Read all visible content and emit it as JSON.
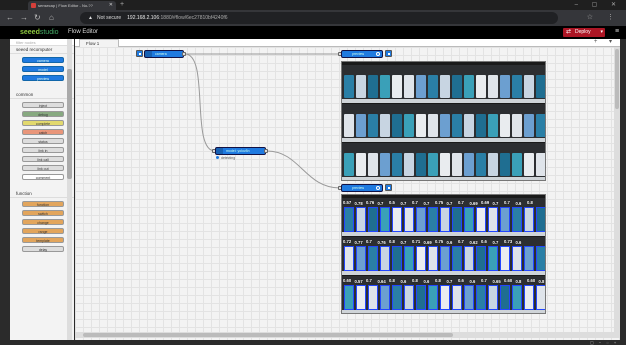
{
  "browser": {
    "tab_title": "sensecap | Flow Editor - No-??",
    "warning": "Not secure",
    "url_host": "192.168.2.106",
    "url_rest": ":1880/#flow/6ec27810bf4240f6"
  },
  "header": {
    "logo": "seeed",
    "logo_suffix": "studio",
    "title": "Flow Editor",
    "deploy_label": "Deploy"
  },
  "palette": {
    "search": "filter nodes",
    "categories": [
      {
        "label": "seeed recomputer",
        "nodes": [
          {
            "label": "camera",
            "style": "blue"
          },
          {
            "label": "model",
            "style": "blue"
          },
          {
            "label": "preview",
            "style": "blue"
          }
        ]
      },
      {
        "label": "common",
        "nodes": [
          {
            "label": "inject",
            "style": "grey"
          },
          {
            "label": "debug",
            "style": "green"
          },
          {
            "label": "complete",
            "style": "salmon"
          },
          {
            "label": "catch",
            "style": "orange"
          },
          {
            "label": "status",
            "style": "grey"
          },
          {
            "label": "link in",
            "style": "grey"
          },
          {
            "label": "link call",
            "style": "grey"
          },
          {
            "label": "link out",
            "style": "grey"
          },
          {
            "label": "comment",
            "style": "white"
          }
        ]
      },
      {
        "label": "function",
        "nodes": [
          {
            "label": "function",
            "style": "yellow"
          },
          {
            "label": "switch",
            "style": "yellow"
          },
          {
            "label": "change",
            "style": "yellow"
          },
          {
            "label": "range",
            "style": "yellow"
          },
          {
            "label": "template",
            "style": "yellow"
          },
          {
            "label": "delay",
            "style": "grey"
          }
        ]
      }
    ]
  },
  "workspace": {
    "tab": "Flow 1",
    "nodes": {
      "camera": "camera",
      "model": "model: yolov8n",
      "model_status": "detecting",
      "preview_top": "preview",
      "preview_bottom": "preview"
    }
  },
  "detections": {
    "row1": [
      "0.57",
      "0.78",
      "0.76",
      "0.7",
      "0.5",
      "0.7",
      "0.7",
      "0.7",
      "0.75",
      "0.7",
      "0.7",
      "0.69",
      "0.69",
      "0.7",
      "0.7",
      "0.6",
      "0.8"
    ],
    "row2": [
      "0.72",
      "0.77",
      "0.7",
      "0.76",
      "0.8",
      "0.7",
      "0.71",
      "0.69",
      "0.75",
      "0.6",
      "0.7",
      "0.62",
      "0.6",
      "0.7",
      "0.73",
      "0.6"
    ],
    "row3": [
      "0.60",
      "0.57",
      "0.7",
      "0.64",
      "0.8",
      "0.6",
      "0.8",
      "0.6",
      "0.8",
      "0.7",
      "0.6",
      "0.6",
      "0.7",
      "0.65",
      "0.60",
      "0.8",
      "0.60",
      "0.8"
    ]
  },
  "colors": {
    "node_blue": "#1f7ae0",
    "deploy_red": "#ad1625",
    "detection_blue": "#2246ff"
  }
}
